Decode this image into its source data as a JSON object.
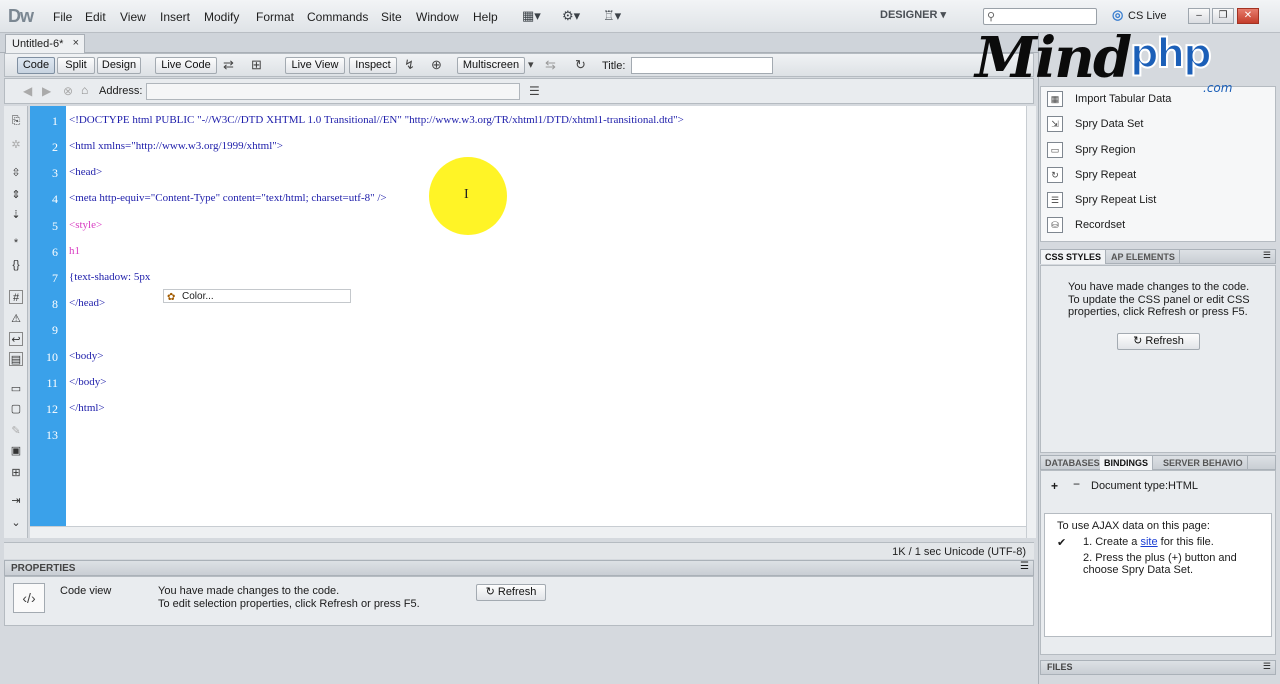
{
  "app": {
    "logo": "Dw"
  },
  "menu": [
    "File",
    "Edit",
    "View",
    "Insert",
    "Modify",
    "Format",
    "Commands",
    "Site",
    "Window",
    "Help"
  ],
  "toolbar_icons": [
    "layout-icon",
    "gear-icon",
    "site-icon"
  ],
  "workspace": "DESIGNER",
  "cslive": "CS Live",
  "document": {
    "tab": "Untitled-6*",
    "close": "×"
  },
  "doc_toolbar": {
    "code": "Code",
    "split": "Split",
    "design": "Design",
    "live_code": "Live Code",
    "live_view": "Live View",
    "inspect": "Inspect",
    "multiscreen": "Multiscreen",
    "title_label": "Title:",
    "title_value": ""
  },
  "address": {
    "label": "Address:",
    "value": ""
  },
  "code_lines": [
    "1",
    "2",
    "3",
    "4",
    "5",
    "6",
    "7",
    "8",
    "9",
    "10",
    "11",
    "12",
    "13"
  ],
  "code": {
    "l1": "<!DOCTYPE html PUBLIC \"-//W3C//DTD XHTML 1.0 Transitional//EN\" \"http://www.w3.org/TR/xhtml1/DTD/xhtml1-transitional.dtd\">",
    "l2": "<html xmlns=\"http://www.w3.org/1999/xhtml\">",
    "l3": "<head>",
    "l4": "<meta http-equiv=\"Content-Type\" content=\"text/html; charset=utf-8\" />",
    "l5": "<style>",
    "l6": "h1",
    "l7": "{text-shadow: 5px",
    "l8": "</head>",
    "l10": "<body>",
    "l11": "</body>",
    "l12": "</html>"
  },
  "code_hint": "Color...",
  "status": "1K / 1 sec  Unicode (UTF-8)",
  "properties": {
    "title": "PROPERTIES",
    "code_view": "Code view",
    "msg1": "You have made changes to the code.",
    "msg2": "To edit selection properties, click Refresh or press F5.",
    "refresh": "Refresh"
  },
  "insert_items": [
    "Import Tabular Data",
    "Spry Data Set",
    "Spry Region",
    "Spry Repeat",
    "Spry Repeat List",
    "Recordset"
  ],
  "css_panel": {
    "tabs": [
      "CSS STYLES",
      "AP ELEMENTS"
    ],
    "msg": "You have made changes to the code. To update the CSS panel or edit CSS properties, click Refresh or press F5.",
    "refresh": "Refresh"
  },
  "bindings_panel": {
    "tabs": [
      "DATABASES",
      "BINDINGS",
      "SERVER BEHAVIO"
    ],
    "doc_type": "Document type:HTML",
    "ajax_title": "To use AJAX data on this page:",
    "step1_pre": "1.  Create a ",
    "step1_link": "site",
    "step1_post": " for this file.",
    "step2": "2.  Press the plus (+) button and choose Spry Data Set."
  },
  "files_panel": {
    "title": "FILES"
  },
  "logo": {
    "mind": "Mind",
    "php": "php",
    "com": ".com"
  }
}
